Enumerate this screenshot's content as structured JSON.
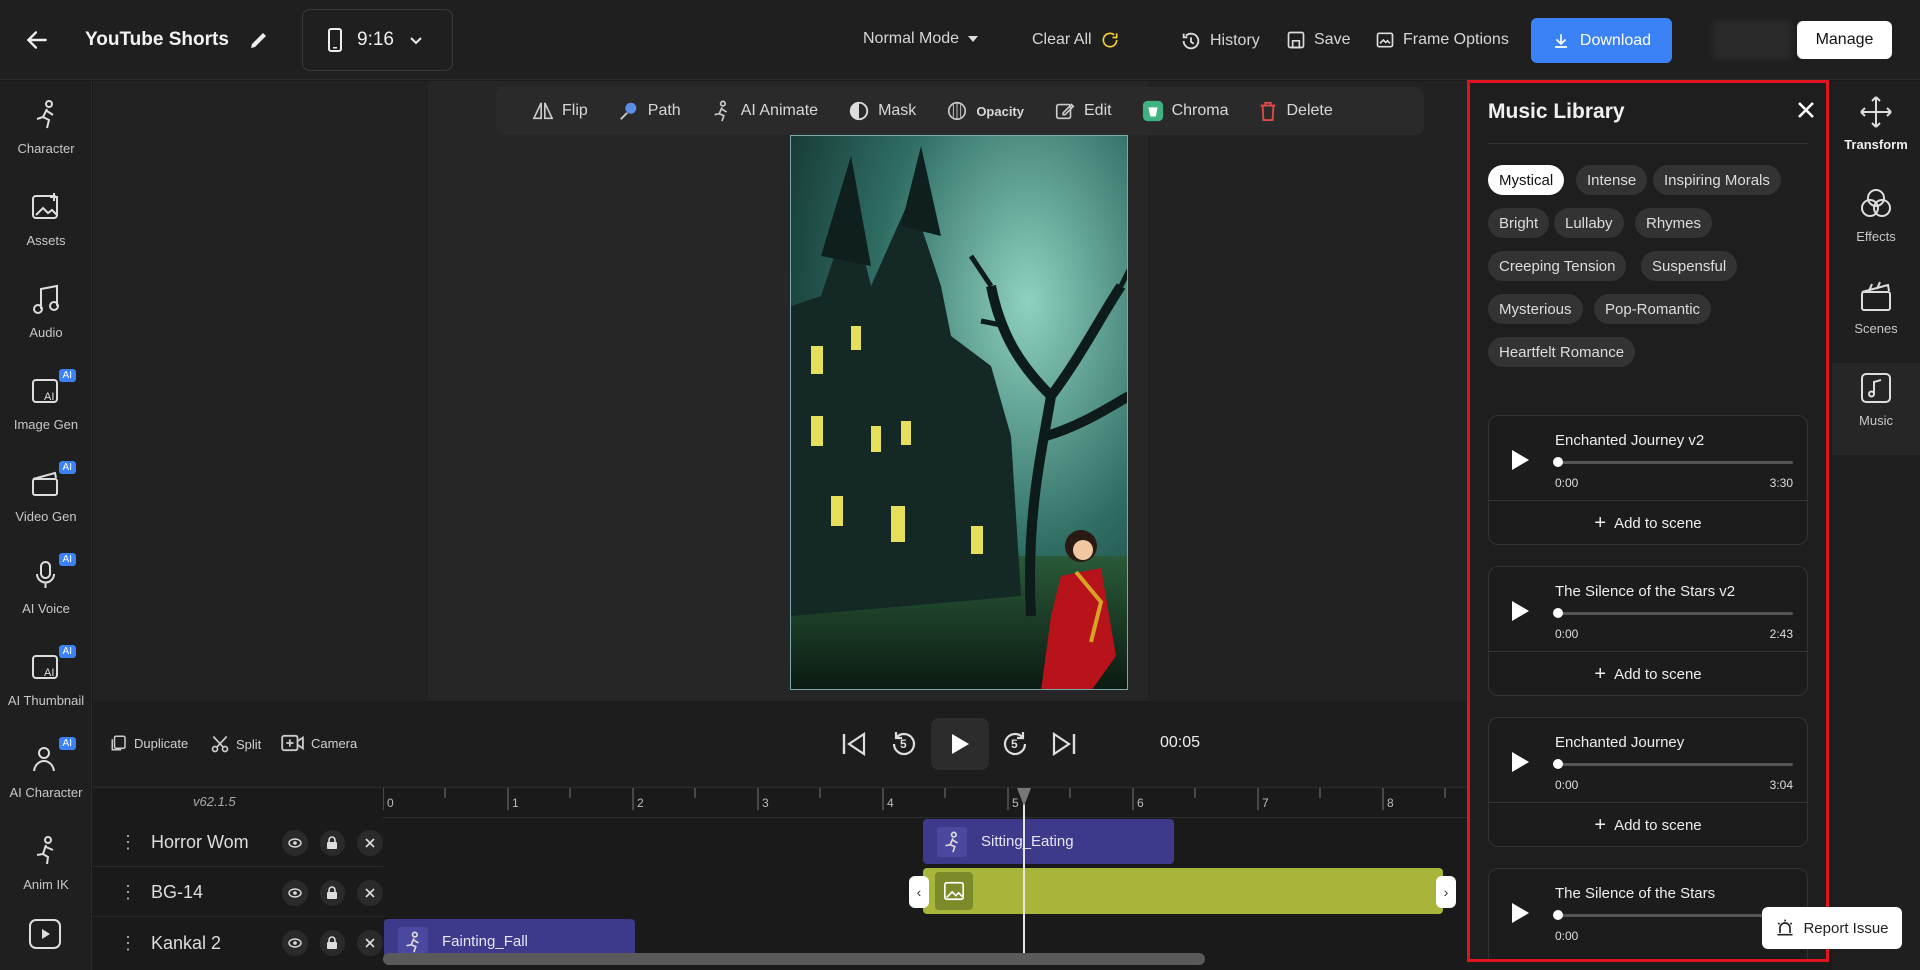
{
  "header": {
    "title": "YouTube Shorts",
    "ratio": "9:16",
    "mode": "Normal Mode",
    "clear_all": "Clear All",
    "history": "History",
    "save": "Save",
    "frame_options": "Frame Options",
    "download": "Download",
    "manage": "Manage"
  },
  "left_sidebar": {
    "items": [
      {
        "label": "Character",
        "icon": "running-figure-icon",
        "ai": false
      },
      {
        "label": "Assets",
        "icon": "image-plus-icon",
        "ai": false
      },
      {
        "label": "Audio",
        "icon": "music-note-icon",
        "ai": false
      },
      {
        "label": "Image Gen",
        "icon": "ai-image-icon",
        "ai": true
      },
      {
        "label": "Video Gen",
        "icon": "clapperboard-icon",
        "ai": true
      },
      {
        "label": "AI Voice",
        "icon": "microphone-icon",
        "ai": true
      },
      {
        "label": "AI Thumbnail",
        "icon": "ai-thumbnail-icon",
        "ai": true
      },
      {
        "label": "AI Character",
        "icon": "person-sparkle-icon",
        "ai": true
      },
      {
        "label": "Anim IK",
        "icon": "skeleton-icon",
        "ai": false
      }
    ],
    "ai_badge": "AI"
  },
  "context_toolbar": {
    "items": [
      "Flip",
      "Path",
      "AI Animate",
      "Mask",
      "Opacity",
      "Edit",
      "Chroma",
      "Delete"
    ]
  },
  "controls": {
    "duplicate": "Duplicate",
    "split": "Split",
    "camera": "Camera",
    "skip_back_value": "5",
    "skip_forward_value": "5",
    "time": "00:05"
  },
  "timeline": {
    "version": "v62.1.5",
    "ruler": [
      "0",
      "1",
      "2",
      "3",
      "4",
      "5",
      "6",
      "7",
      "8"
    ],
    "tracks": [
      {
        "name": "Horror Wom",
        "clip": "Sitting_Eating"
      },
      {
        "name": "BG-14",
        "clip": ""
      },
      {
        "name": "Kankal 2",
        "clip": "Fainting_Fall"
      }
    ]
  },
  "music_library": {
    "title": "Music Library",
    "chips": [
      [
        "Mystical",
        "Intense",
        "Inspiring Morals"
      ],
      [
        "Bright",
        "Lullaby",
        "Rhymes"
      ],
      [
        "Creeping Tension",
        "Suspensful"
      ],
      [
        "Mysterious",
        "Pop-Romantic"
      ],
      [
        "Heartfelt Romance"
      ]
    ],
    "active_chip": "Mystical",
    "add_label": "Add to scene",
    "tracks": [
      {
        "title": "Enchanted Journey v2",
        "current": "0:00",
        "duration": "3:30"
      },
      {
        "title": "The Silence of the Stars v2",
        "current": "0:00",
        "duration": "2:43"
      },
      {
        "title": "Enchanted Journey",
        "current": "0:00",
        "duration": "3:04"
      },
      {
        "title": "The Silence of the Stars",
        "current": "0:00",
        "duration": ""
      }
    ]
  },
  "right_sidebar": {
    "items": [
      "Transform",
      "Effects",
      "Scenes",
      "Music"
    ]
  },
  "report_issue": "Report Issue",
  "colors": {
    "accent": "#3b82f6",
    "highlight_border": "#e0141e",
    "clip_purple": "#3d3a8c",
    "clip_green": "#a8b53a"
  }
}
